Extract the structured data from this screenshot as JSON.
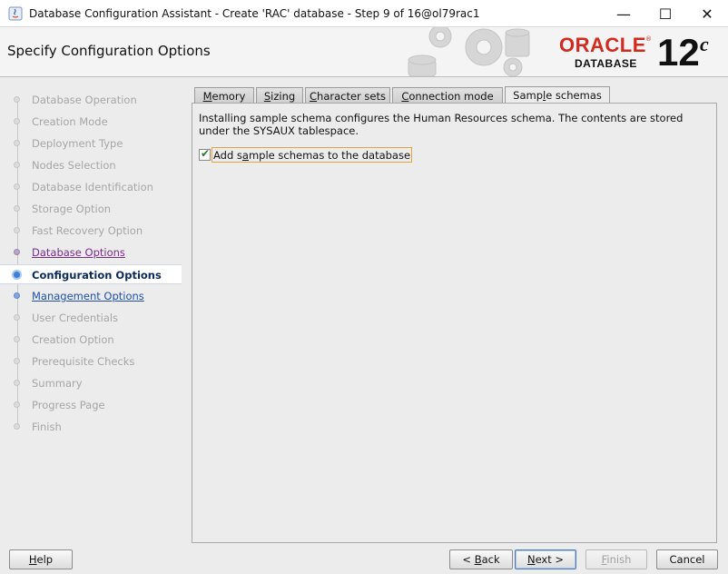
{
  "window": {
    "title": "Database Configuration Assistant - Create 'RAC' database - Step 9 of 16@ol79rac1",
    "minimize": "—",
    "maximize": "☐",
    "close": "✕"
  },
  "header": {
    "page_title": "Specify Configuration Options",
    "logo_oracle": "ORACLE",
    "logo_reg": "®",
    "logo_database": "DATABASE",
    "logo_version": "12",
    "logo_version_suffix": "c"
  },
  "steps": [
    {
      "label": "Database Operation",
      "state": "disabled"
    },
    {
      "label": "Creation Mode",
      "state": "disabled"
    },
    {
      "label": "Deployment Type",
      "state": "disabled"
    },
    {
      "label": "Nodes Selection",
      "state": "disabled"
    },
    {
      "label": "Database Identification",
      "state": "disabled"
    },
    {
      "label": "Storage Option",
      "state": "disabled"
    },
    {
      "label": "Fast Recovery Option",
      "state": "disabled"
    },
    {
      "label": "Database Options",
      "state": "visited"
    },
    {
      "label": "Configuration Options",
      "state": "current"
    },
    {
      "label": "Management Options",
      "state": "next"
    },
    {
      "label": "User Credentials",
      "state": "disabled"
    },
    {
      "label": "Creation Option",
      "state": "disabled"
    },
    {
      "label": "Prerequisite Checks",
      "state": "disabled"
    },
    {
      "label": "Summary",
      "state": "disabled"
    },
    {
      "label": "Progress Page",
      "state": "disabled"
    },
    {
      "label": "Finish",
      "state": "disabled"
    }
  ],
  "tabs": [
    {
      "pre": "",
      "u": "M",
      "post": "emory",
      "active": false
    },
    {
      "pre": "",
      "u": "S",
      "post": "izing",
      "active": false
    },
    {
      "pre": "",
      "u": "C",
      "post": "haracter sets",
      "active": false
    },
    {
      "pre": "",
      "u": "C",
      "post": "onnection mode",
      "active": false
    },
    {
      "pre": "Samp",
      "u": "l",
      "post": "e schemas",
      "active": true
    }
  ],
  "panel": {
    "description_line1": "Installing sample schema configures the Human Resources schema. The contents are stored",
    "description_line2": "under the SYSAUX tablespace.",
    "checkbox_pre": "Add s",
    "checkbox_u": "a",
    "checkbox_post": "mple schemas to the database",
    "checkbox_checked": true,
    "checkmark": "✔"
  },
  "buttons": {
    "help": {
      "u": "H",
      "post": "elp"
    },
    "back": {
      "pre": "< ",
      "u": "B",
      "post": "ack"
    },
    "next": {
      "u": "N",
      "post": "ext >"
    },
    "finish": {
      "u": "F",
      "post": "inish"
    },
    "cancel": {
      "label": "Cancel"
    }
  },
  "colors": {
    "oracle_red": "#d12a1f",
    "current_step": "#0c2a60",
    "visited_step": "#7a2b8f",
    "next_step": "#1f4fb0",
    "focus_orange": "#e8a33d"
  }
}
